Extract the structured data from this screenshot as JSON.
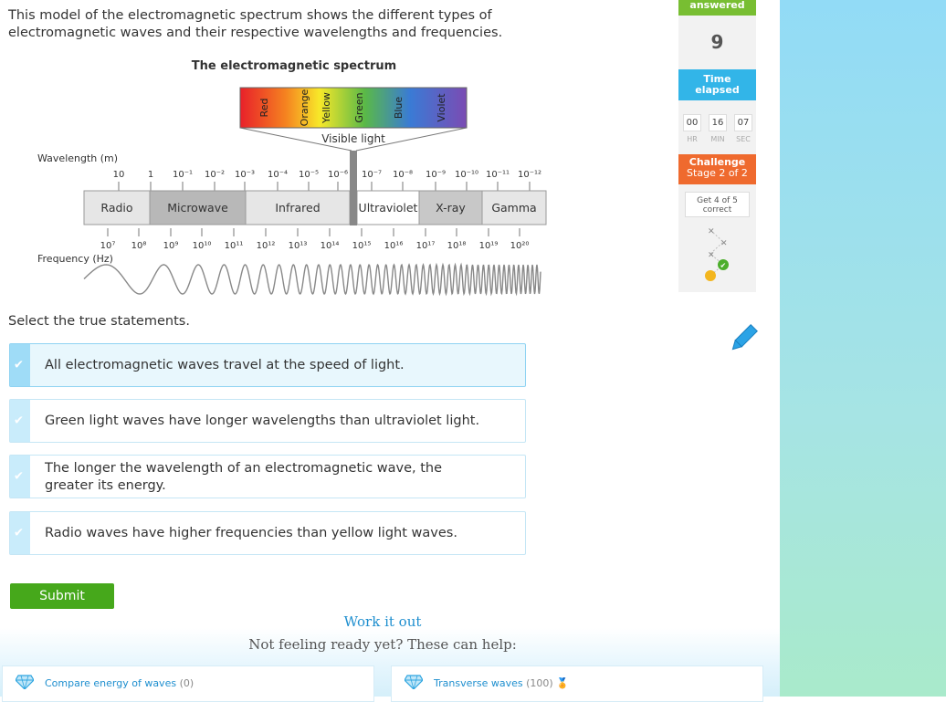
{
  "question": {
    "intro": "This model of the electromagnetic spectrum shows the different types of electromagnetic waves and their respective wavelengths and frequencies.",
    "prompt": "Select the true statements."
  },
  "diagram": {
    "title": "The electromagnetic spectrum",
    "visible_colors": [
      "Red",
      "Orange",
      "Yellow",
      "Green",
      "Blue",
      "Violet"
    ],
    "visible_label": "Visible light",
    "wavelength_label": "Wavelength (m)",
    "frequency_label": "Frequency (Hz)",
    "wavelength_ticks": [
      "10",
      "1",
      "10⁻¹",
      "10⁻²",
      "10⁻³",
      "10⁻⁴",
      "10⁻⁵",
      "10⁻⁶",
      "10⁻⁷",
      "10⁻⁸",
      "10⁻⁹",
      "10⁻¹⁰",
      "10⁻¹¹",
      "10⁻¹²"
    ],
    "frequency_ticks": [
      "10⁷",
      "10⁸",
      "10⁹",
      "10¹⁰",
      "10¹¹",
      "10¹²",
      "10¹³",
      "10¹⁴",
      "10¹⁵",
      "10¹⁶",
      "10¹⁷",
      "10¹⁸",
      "10¹⁹",
      "10²⁰"
    ],
    "bands": [
      "Radio",
      "Microwave",
      "Infrared",
      "Ultraviolet",
      "X-ray",
      "Gamma"
    ]
  },
  "choices": [
    {
      "text": "All electromagnetic waves travel at the speed of light.",
      "selected": true
    },
    {
      "text": "Green light waves have longer wavelengths than ultraviolet light.",
      "selected": false
    },
    {
      "text": "The longer the wavelength of an electromagnetic wave, the greater its energy.",
      "selected": false
    },
    {
      "text": "Radio waves have higher frequencies than yellow light waves.",
      "selected": false
    }
  ],
  "submit_label": "Submit",
  "help": {
    "work_it_out": "Work it out",
    "not_ready": "Not feeling ready yet? These can help:",
    "skills": [
      {
        "name": "Compare energy of waves",
        "count": "(0)"
      },
      {
        "name": "Transverse waves",
        "count": "(100)"
      }
    ]
  },
  "sidebar": {
    "answered_label": "answered",
    "answered_count": "9",
    "time_label_1": "Time",
    "time_label_2": "elapsed",
    "hours": "00",
    "minutes": "16",
    "seconds": "07",
    "hr_label": "HR",
    "min_label": "MIN",
    "sec_label": "SEC",
    "challenge_label": "Challenge",
    "stage_label": "Stage 2 of 2",
    "goal_line1": "Get 4 of 5",
    "goal_line2": "correct"
  },
  "colors": {
    "accent_blue": "#32b5e8",
    "answered_green": "#78be32",
    "challenge_orange": "#ef6a2e",
    "submit_green": "#46a81b"
  }
}
